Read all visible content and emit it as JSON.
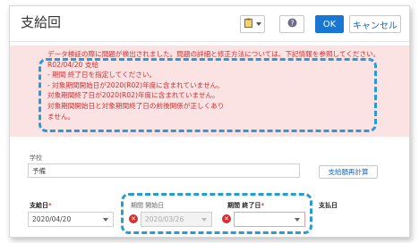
{
  "dialog": {
    "title": "支給回",
    "toolbar": {
      "ok_label": "OK",
      "cancel_label": "キャンセル",
      "help_icon": "help-icon",
      "tool_icon": "clipboard-icon"
    }
  },
  "errors": {
    "lines": [
      "データ検証の際に問題が検出されました。問題の詳細と修正方法については、下記情報を参照してください。",
      "R02/04/20 支給",
      "- 期間 終了日を指定してください。",
      "- 対象期間開始日が2020(R02)年度に含まれていません。",
      "対象期間終了日が2020(R02)年度に含まれていません。",
      "対象期間開始日と対象期間終了日の前後関係が正しくあり",
      "ません。"
    ]
  },
  "form": {
    "school_label": "学校",
    "school_value": "予備",
    "recalc_label": "支給額再計算",
    "pay_date_label": "支給日",
    "pay_date_value": "2020/04/20",
    "period_start_label": "期間 開始日",
    "period_start_value": "2020/03/26",
    "period_end_label": "期間 終了日",
    "period_end_value": "",
    "payment_date_label": "支払日",
    "required_mark": "*"
  },
  "colors": {
    "accent": "#1976d2",
    "error": "#d32f2f",
    "error_bg": "#fbe3e4",
    "highlight": "#2a9ad6"
  }
}
